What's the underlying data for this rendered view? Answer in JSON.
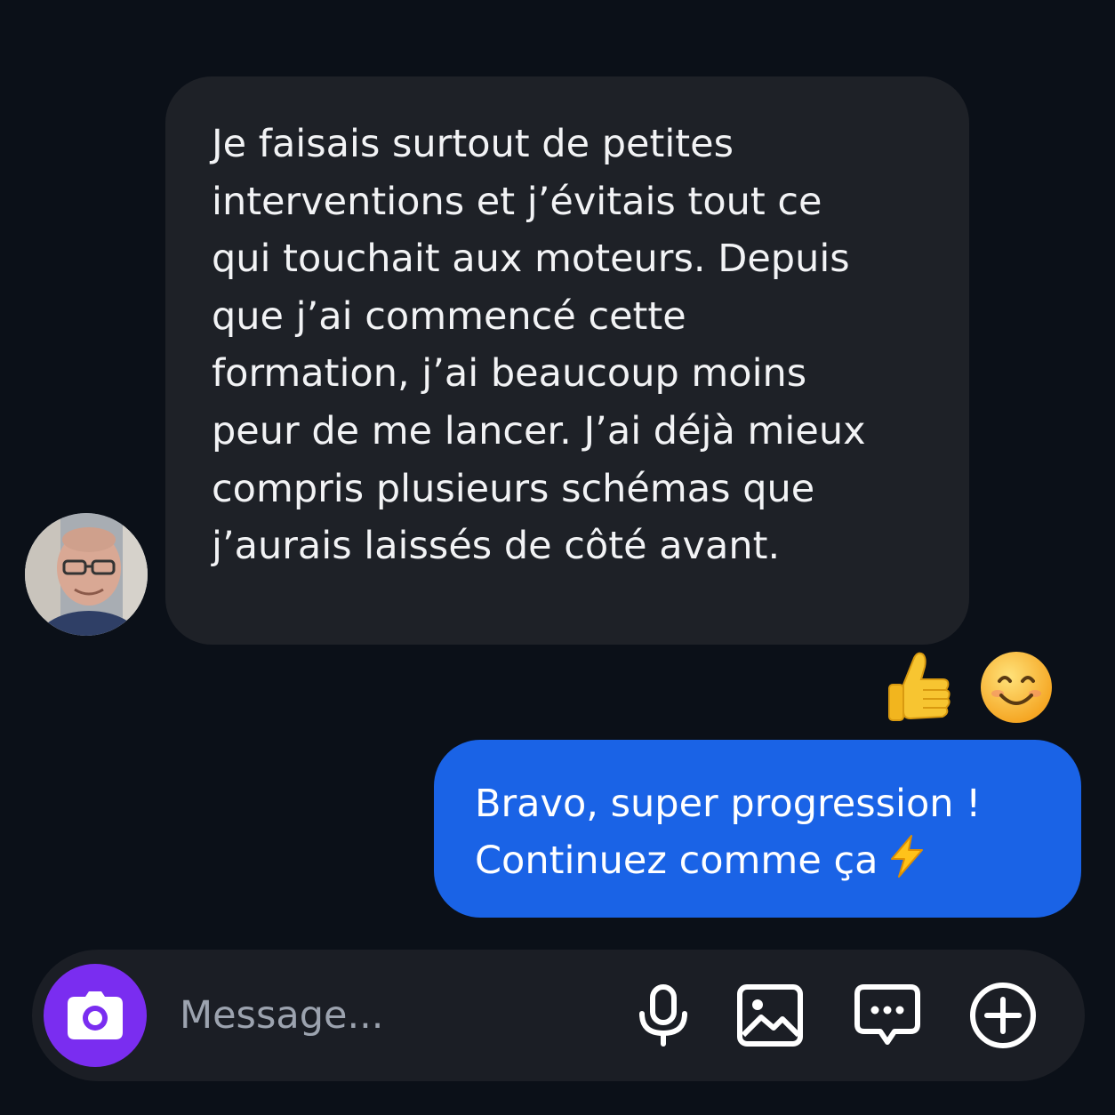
{
  "conversation": {
    "incoming": {
      "lines": [
        "Je faisais surtout de petites",
        "interventions et j’évitais tout ce",
        "qui touchait aux moteurs. Depuis",
        "que j’ai commencé cette",
        "formation, j’ai beaucoup moins",
        "peur de me lancer. J’ai déjà mieux",
        "compris plusieurs schémas que",
        "j’aurais laissés de côté avant."
      ],
      "avatar": "avatar-photo"
    },
    "reactions": [
      {
        "emoji": "👍",
        "icon": "thumbs-up-icon"
      },
      {
        "emoji": "😊",
        "icon": "smiling-face-icon"
      }
    ],
    "outgoing": {
      "line1": "Bravo, super progression !",
      "line2": "Continuez comme ça",
      "trailing_emoji": "⚡"
    }
  },
  "composer": {
    "placeholder": "Message...",
    "camera_icon": "camera-icon",
    "actions": [
      "microphone-icon",
      "image-icon",
      "chat-bubble-icon",
      "plus-icon"
    ]
  },
  "colors": {
    "background": "#0b1018",
    "incoming_bubble": "#1e2127",
    "outgoing_bubble": "#1a63e6",
    "composer": "#1b1e25",
    "camera_button": "#7a2df0"
  }
}
